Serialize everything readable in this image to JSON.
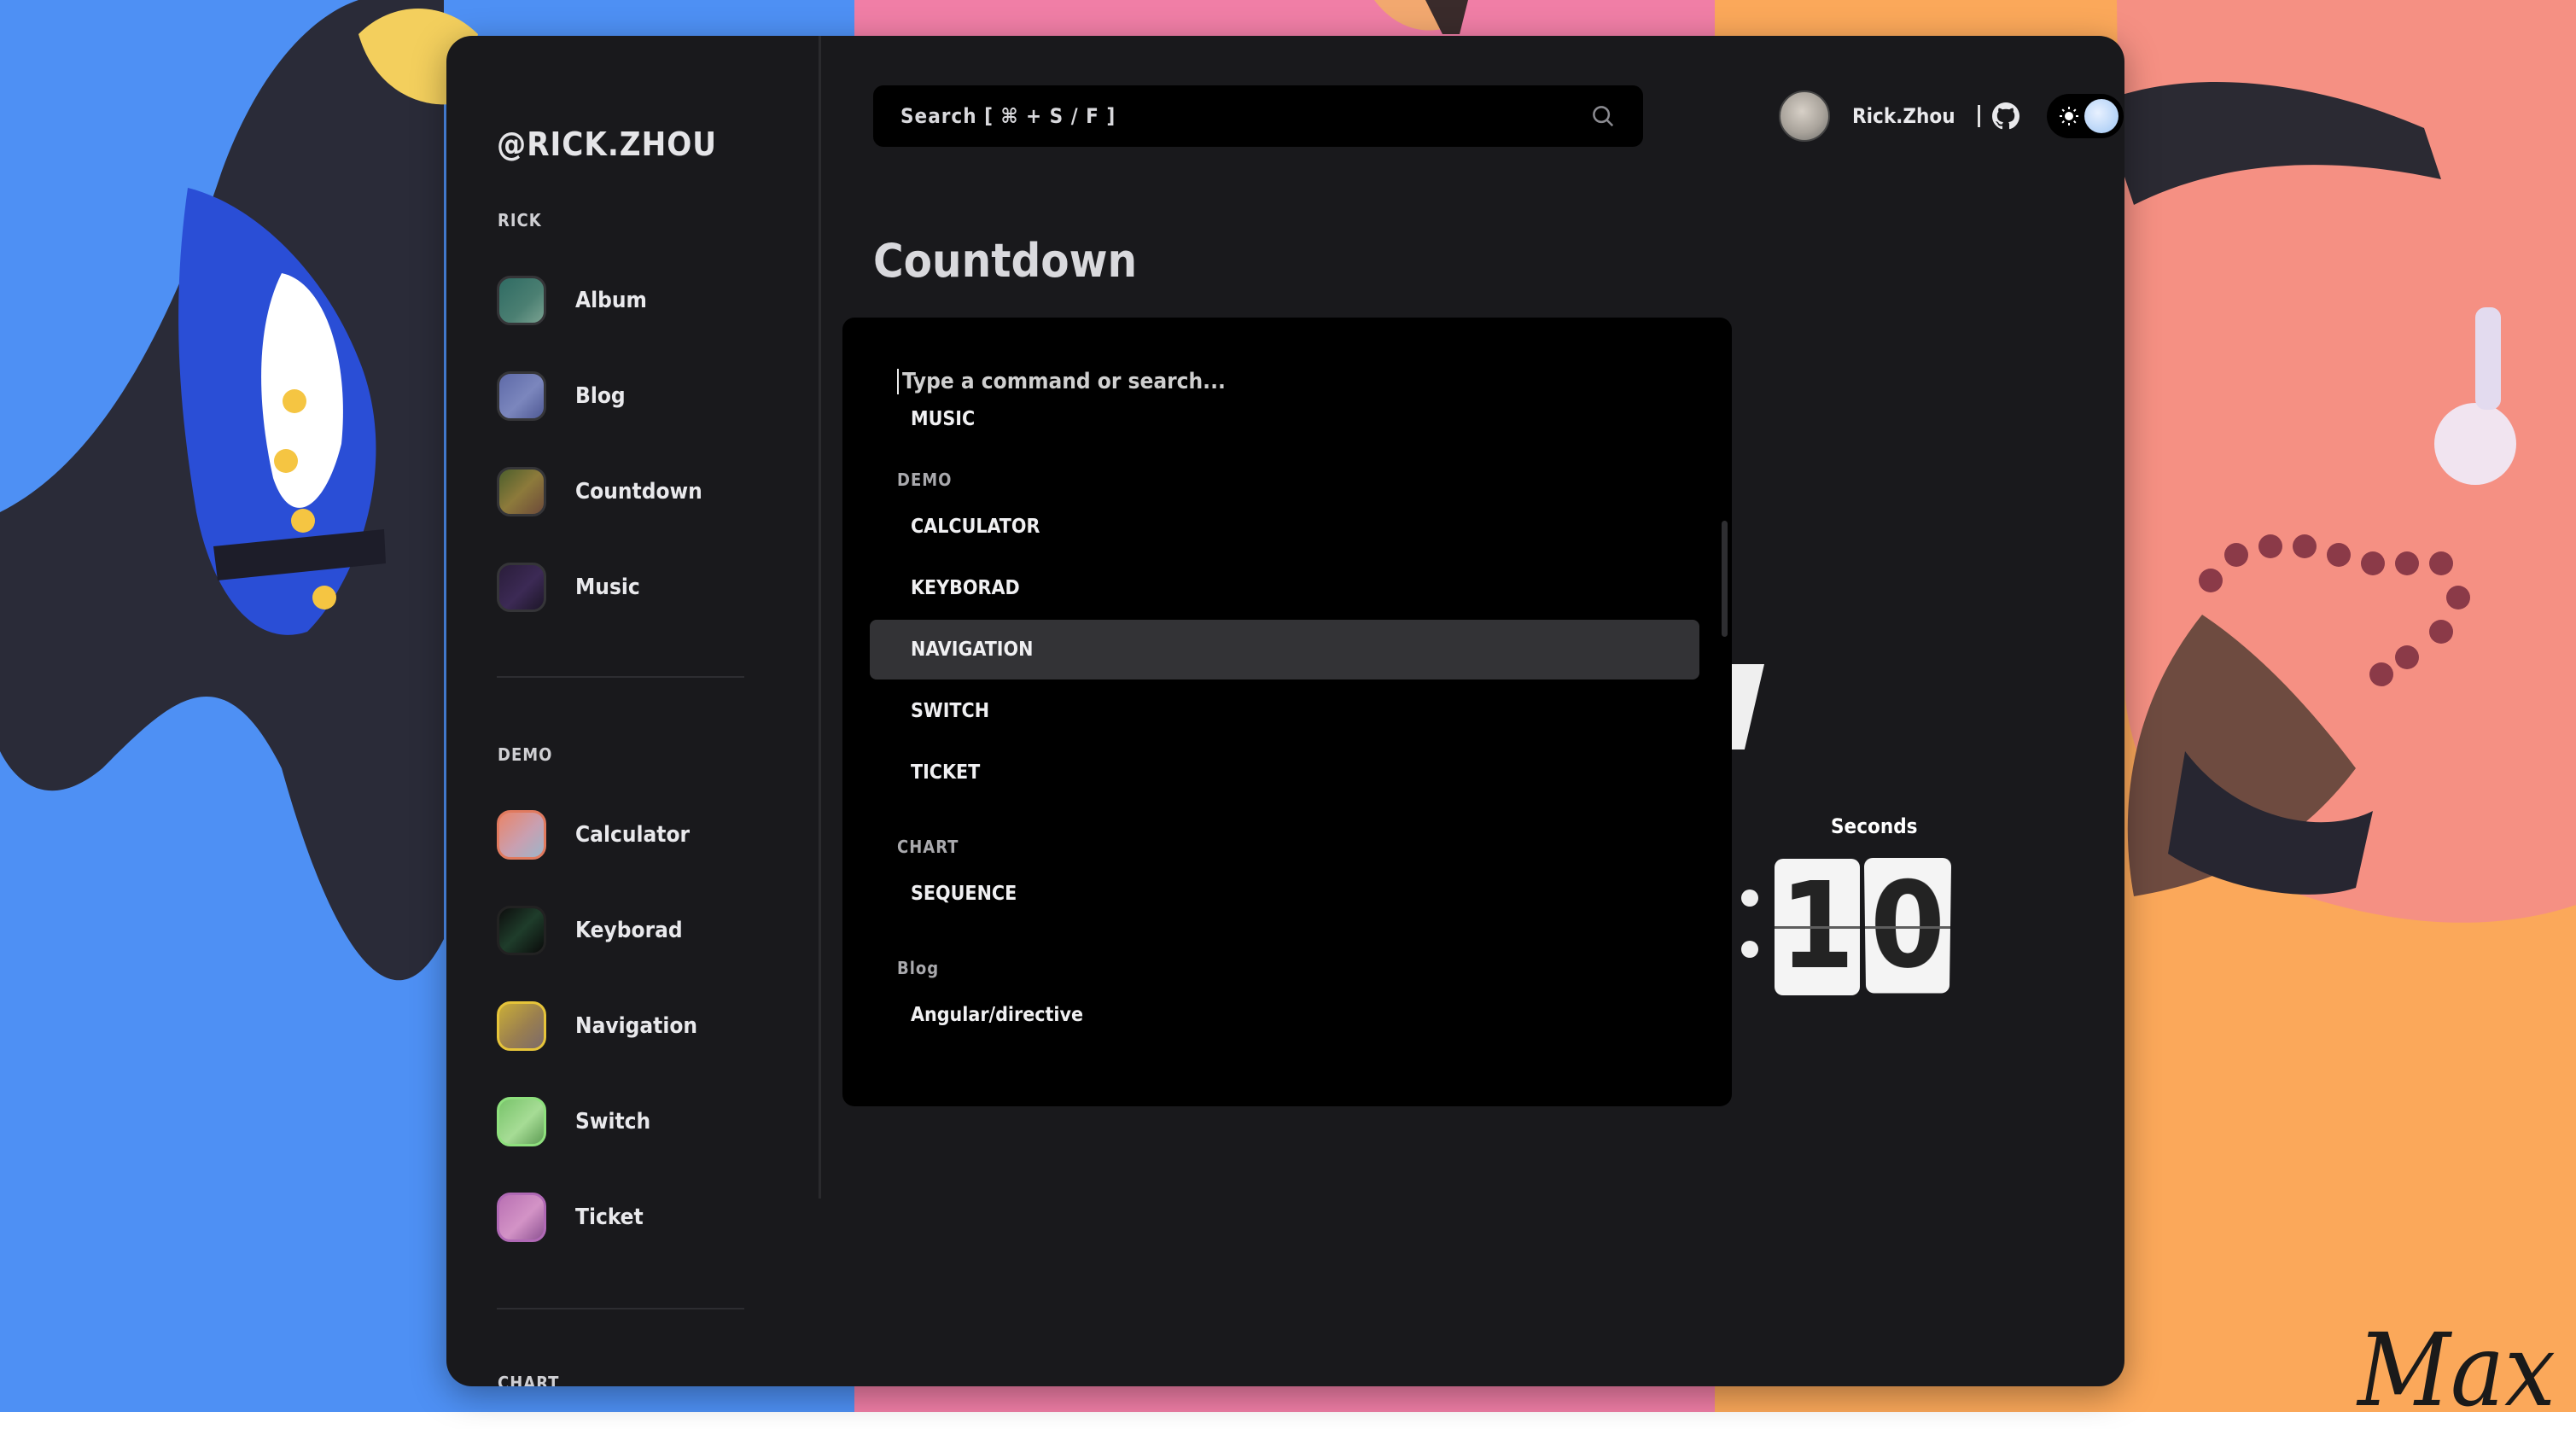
{
  "background": {
    "colors": [
      "#4e90f4",
      "#f07ea6",
      "#fba85a"
    ],
    "signature": "Max"
  },
  "sidebar": {
    "logo": "@RICK.ZHOU",
    "sections": [
      {
        "label": "RICK",
        "items": [
          {
            "label": "Album",
            "thumb": "album-thumbnail"
          },
          {
            "label": "Blog",
            "thumb": "blog-thumbnail"
          },
          {
            "label": "Countdown",
            "thumb": "countdown-thumbnail"
          },
          {
            "label": "Music",
            "thumb": "music-thumbnail"
          }
        ]
      },
      {
        "label": "DEMO",
        "items": [
          {
            "label": "Calculator",
            "thumb": "calculator-thumbnail"
          },
          {
            "label": "Keyborad",
            "thumb": "keyboard-thumbnail"
          },
          {
            "label": "Navigation",
            "thumb": "navigation-thumbnail"
          },
          {
            "label": "Switch",
            "thumb": "switch-thumbnail"
          },
          {
            "label": "Ticket",
            "thumb": "ticket-thumbnail"
          }
        ]
      },
      {
        "label": "CHART",
        "items": []
      }
    ]
  },
  "header": {
    "search_label": "Search  [ ⌘ + S / F ]",
    "search_icon": "search-icon",
    "user_name": "Rick.Zhou",
    "github_icon": "github-icon",
    "theme_icon": "sun-icon"
  },
  "page": {
    "title": "Countdown"
  },
  "countdown": {
    "unit_label": "Seconds",
    "seconds_digits": [
      "1",
      "0"
    ]
  },
  "palette": {
    "placeholder": "Type a command or search...",
    "groups": [
      {
        "label": "",
        "items": [
          {
            "label": "MUSIC"
          }
        ]
      },
      {
        "label": "DEMO",
        "items": [
          {
            "label": "CALCULATOR"
          },
          {
            "label": "KEYBORAD"
          },
          {
            "label": "NAVIGATION",
            "active": true
          },
          {
            "label": "SWITCH"
          },
          {
            "label": "TICKET"
          }
        ]
      },
      {
        "label": "CHART",
        "items": [
          {
            "label": "SEQUENCE"
          }
        ]
      },
      {
        "label": "Blog",
        "items": [
          {
            "label": "Angular/directive"
          }
        ]
      }
    ]
  }
}
